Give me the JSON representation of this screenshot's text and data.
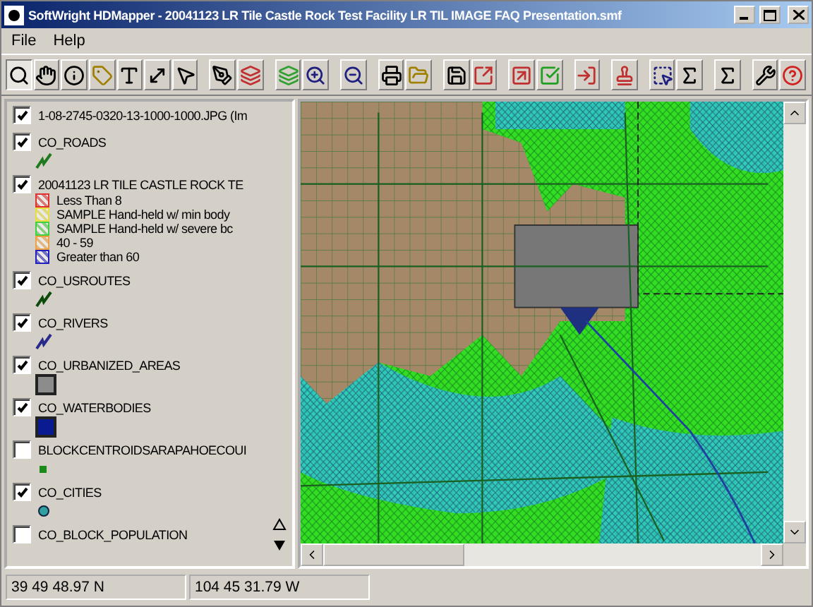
{
  "window": {
    "title": "SoftWright HDMapper - 20041123 LR Tile Castle Rock Test Facility LR TIL IMAGE FAQ Presentation.smf"
  },
  "menu": [
    "File",
    "Help"
  ],
  "toolbar": [
    {
      "selected": true
    },
    {
      "selected": false
    },
    {
      "selected": false
    },
    {
      "selected": false
    },
    {
      "selected": false
    },
    {
      "selected": false
    },
    {
      "selected": false
    },
    {
      "selected": false
    },
    {
      "selected": false
    },
    {
      "selected": false
    },
    {
      "selected": false
    },
    {
      "selected": false
    },
    {
      "selected": false
    },
    {
      "selected": false
    },
    {
      "selected": false
    },
    {
      "selected": false
    },
    {
      "selected": false
    },
    {
      "selected": false
    },
    {
      "selected": false
    },
    {
      "selected": false
    },
    {
      "selected": false
    },
    {
      "selected": false
    },
    {
      "selected": false
    },
    {
      "selected": false
    },
    {
      "selected": false
    }
  ],
  "layers": [
    {
      "name": "1-08-2745-0320-13-1000-1000.JPG (Im",
      "checked": true,
      "kind": "image"
    },
    {
      "name": "CO_ROADS",
      "checked": true,
      "kind": "line",
      "color": "#1f7a1f"
    },
    {
      "name": "20041123 LR TILE CASTLE ROCK TE",
      "checked": true,
      "kind": "classes",
      "classes": [
        {
          "label": "Less Than 8",
          "color": "#e03030"
        },
        {
          "label": "SAMPLE Hand-held w/ min body",
          "color": "#e8e040"
        },
        {
          "label": "SAMPLE Hand-held w/ severe bc",
          "color": "#40d040"
        },
        {
          "label": "40 - 59",
          "color": "#f0a040"
        },
        {
          "label": "Greater than 60",
          "color": "#2020c0"
        }
      ]
    },
    {
      "name": "CO_USROUTES",
      "checked": true,
      "kind": "line",
      "color": "#0a4a0a"
    },
    {
      "name": "CO_RIVERS",
      "checked": true,
      "kind": "line",
      "color": "#2a2a8a"
    },
    {
      "name": "CO_URBANIZED_AREAS",
      "checked": true,
      "kind": "fill",
      "color": "#8c8c8c"
    },
    {
      "name": "CO_WATERBODIES",
      "checked": true,
      "kind": "fill",
      "color": "#0a1a90"
    },
    {
      "name": "BLOCKCENTROIDSARAPAHOECOUI",
      "checked": false,
      "kind": "point",
      "color": "#1a8a1a"
    },
    {
      "name": "CO_CITIES",
      "checked": true,
      "kind": "dot",
      "color": "#30a0a0"
    },
    {
      "name": "CO_BLOCK_POPULATION",
      "checked": false,
      "kind": "image"
    }
  ],
  "status_bar": [
    "39 49 48.97 N",
    "104 45 31.79 W"
  ]
}
